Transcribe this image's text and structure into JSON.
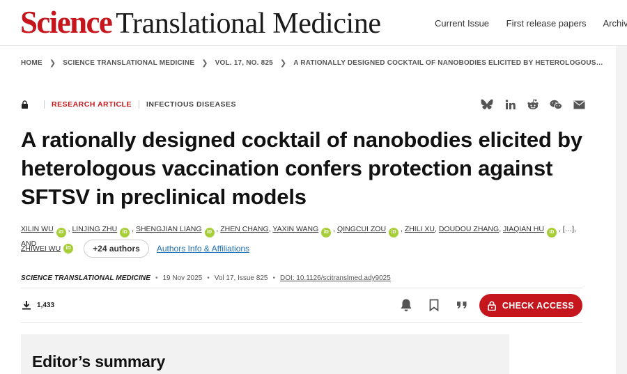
{
  "header": {
    "logo_science": "Science",
    "logo_rest": "Translational Medicine",
    "nav": [
      "Current Issue",
      "First release papers",
      "Archive"
    ]
  },
  "breadcrumb": [
    "HOME",
    "SCIENCE TRANSLATIONAL MEDICINE",
    "VOL. 17, NO. 825",
    "A RATIONALLY DESIGNED COCKTAIL OF NANOBODIES ELICITED BY HETEROLOGOUS…"
  ],
  "article": {
    "type": "RESEARCH ARTICLE",
    "subject": "INFECTIOUS DISEASES",
    "title": "A rationally designed cocktail of nanobodies elicited by heterologous vaccination confers protection against SFTSV in preclinical models",
    "more_authors": "+24 authors",
    "affiliations_link": "Authors Info & Affiliations"
  },
  "authors": {
    "a1": "XILIN WU",
    "a2": "LINJING ZHU",
    "a3": "SHENGJIAN LIANG",
    "a4": "ZHEN CHANG",
    "a5": "YAXIN WANG",
    "a6": "QINGCUI ZOU",
    "a7": "ZHILI XU",
    "a8": "DOUDOU ZHANG",
    "a9": "JIAQIAN HU",
    "a10": "ZHIWEI WU",
    "ellipsis": "[…]",
    "and": ", AND",
    "orcid_glyph": "iD"
  },
  "meta": {
    "journal": "SCIENCE TRANSLATIONAL MEDICINE",
    "date": "19 Nov 2025",
    "volume": "Vol 17, Issue 825",
    "doi": "DOI: 10.1126/scitranslmed.ady9025",
    "separator": "•"
  },
  "actions": {
    "downloads": "1,433",
    "check_access": "CHECK ACCESS"
  },
  "summary": {
    "title": "Editor’s summary"
  },
  "colors": {
    "brand_red": "#c4161c",
    "orcid_green": "#a6ce39",
    "link_blue": "#1f6fb2"
  },
  "icons": [
    "lock-icon",
    "bluesky-icon",
    "linkedin-icon",
    "reddit-icon",
    "wechat-icon",
    "email-icon",
    "download-icon",
    "bell-icon",
    "bookmark-icon",
    "quote-icon",
    "chevron-right-icon"
  ]
}
